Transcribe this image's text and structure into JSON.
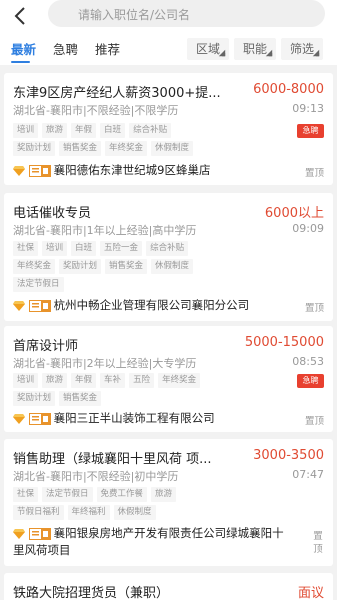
{
  "search": {
    "placeholder": "请输入职位名/公司名"
  },
  "tabs": [
    {
      "label": "最新"
    },
    {
      "label": "急聘"
    },
    {
      "label": "推荐"
    }
  ],
  "filters": [
    {
      "label": "区域"
    },
    {
      "label": "职能"
    },
    {
      "label": "筛选"
    }
  ],
  "colors": {
    "accent": "#2f7fe0",
    "salary": "#e04b33",
    "urgent_badge": "#e8402f"
  },
  "icons": {
    "back": "chevron-left-icon",
    "diamond": "diamond-icon",
    "certified": "certified-badge-icon"
  },
  "jobs": [
    {
      "title": "东津9区房产经纪人薪资3000+提...",
      "salary": "6000-8000",
      "meta": "湖北省-襄阳市|不限经验|不限学历",
      "time": "09:13",
      "urgent_label": "急聘",
      "tags_row1": [
        "培训",
        "旅游",
        "年假",
        "白班",
        "综合补贴"
      ],
      "tags_row2": [
        "奖励计划",
        "销售奖金",
        "年终奖金",
        "休假制度"
      ],
      "company": "襄阳德佑东津世纪城9区蜂巢店",
      "pin": "置顶"
    },
    {
      "title": "电话催收专员",
      "salary": "6000以上",
      "meta": "湖北省-襄阳市|1年以上经验|高中学历",
      "time": "09:09",
      "tags_row1": [
        "社保",
        "培训",
        "白班",
        "五险一金",
        "综合补贴"
      ],
      "tags_row2": [
        "年终奖金",
        "奖励计划",
        "销售奖金",
        "休假制度"
      ],
      "tags_row3": [
        "法定节假日"
      ],
      "company": "杭州中畅企业管理有限公司襄阳分公司",
      "pin": "置顶"
    },
    {
      "title": "首席设计师",
      "salary": "5000-15000",
      "meta": "湖北省-襄阳市|2年以上经验|大专学历",
      "time": "08:53",
      "urgent_label": "急聘",
      "tags_row1": [
        "培训",
        "旅游",
        "年假",
        "车补",
        "五险",
        "年终奖金"
      ],
      "tags_row2": [
        "奖励计划",
        "销售奖金"
      ],
      "company": "襄阳三正半山装饰工程有限公司",
      "pin": "置顶"
    },
    {
      "title": "销售助理（绿城襄阳十里风荷 项...",
      "salary": "3000-3500",
      "meta": "湖北省-襄阳市|不限经验|初中学历",
      "time": "07:47",
      "tags_row1": [
        "社保",
        "法定节假日",
        "免费工作餐",
        "旅游"
      ],
      "tags_row2": [
        "节假日福利",
        "年终福利",
        "休假制度"
      ],
      "company": "襄阳银泉房地产开发有限责任公司绿城襄阳十里风荷项目",
      "pin": "置顶"
    },
    {
      "title": "铁路大院招理货员（兼职）",
      "salary": "面议"
    }
  ]
}
